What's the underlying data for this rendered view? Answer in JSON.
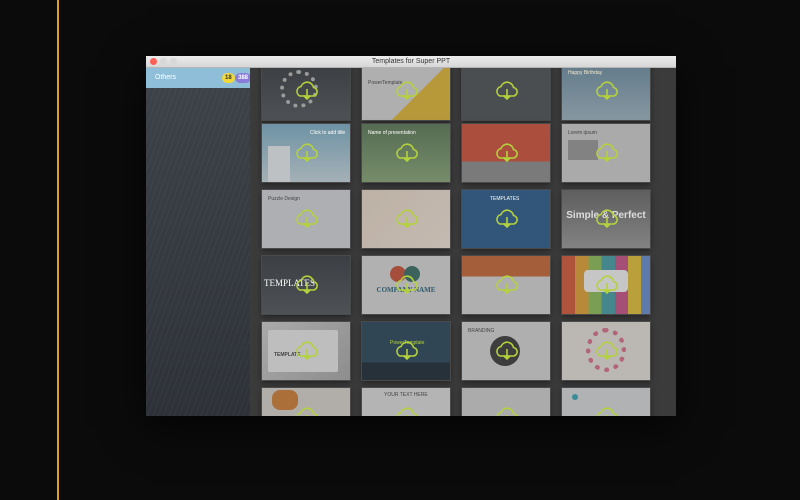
{
  "window": {
    "title": "Templates  for Super PPT"
  },
  "sidebar": {
    "items": [
      {
        "label": "Others",
        "count": "18",
        "total": "388"
      }
    ]
  },
  "colors": {
    "accent": "#e0a21a",
    "sidebar_selected": "#8fbfd8",
    "cloud_icon": "#b4d23c"
  },
  "tiles": [
    {
      "label": ""
    },
    {
      "label": "PowerTemplate"
    },
    {
      "label": ""
    },
    {
      "label": "Happy Birthday"
    },
    {
      "label": "Click to add title"
    },
    {
      "label": "Name of presentation"
    },
    {
      "label": ""
    },
    {
      "label": "Lorem ipsum"
    },
    {
      "label": "Puzzle Design"
    },
    {
      "label": ""
    },
    {
      "label": "TEMPLATES"
    },
    {
      "label": "Simple & Perfect"
    },
    {
      "label": "TEMPLATES"
    },
    {
      "label": "COMPANY NAME"
    },
    {
      "label": ""
    },
    {
      "label": ""
    },
    {
      "label": "TEMPLATE"
    },
    {
      "label": "PowerTemplate"
    },
    {
      "label": "BRANDING"
    },
    {
      "label": ""
    },
    {
      "label": ""
    },
    {
      "label": "YOUR TEXT HERE"
    },
    {
      "label": ""
    },
    {
      "label": ""
    }
  ]
}
